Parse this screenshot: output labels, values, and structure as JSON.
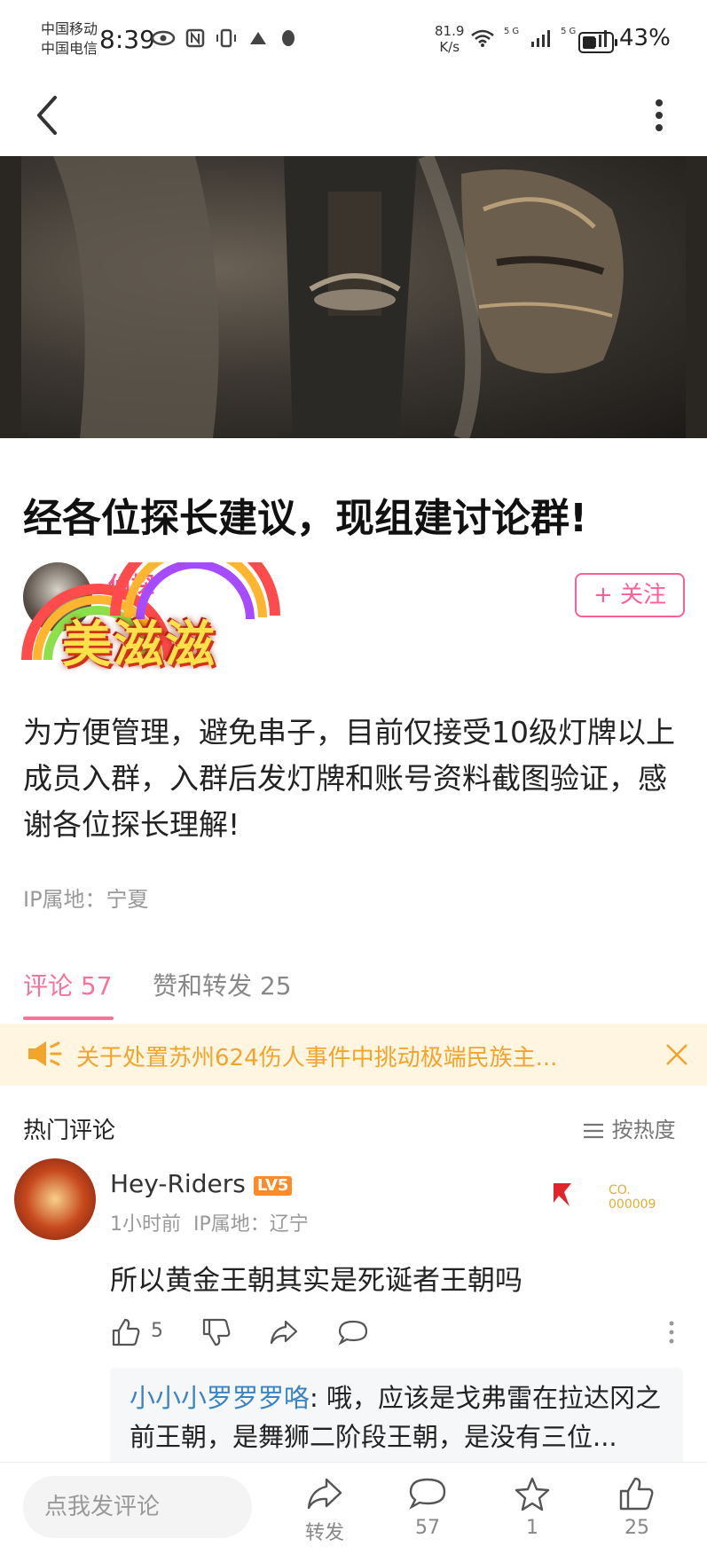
{
  "status_bar": {
    "carrier1": "中国移动",
    "carrier2": "中国电信",
    "time": "8:39",
    "speed_value": "81.9",
    "speed_unit": "K/s",
    "battery": "43%",
    "network1": "5G",
    "network2": "5G"
  },
  "post": {
    "title": "经各位探长建议，现组建讨论群!",
    "author_name": "侦探",
    "follow_label": "+ 关注",
    "badge_text": "美滋滋",
    "body": "为方便管理，避免串子，目前仅接受10级灯牌以上成员入群，入群后发灯牌和账号资料截图验证，感谢各位探长理解!",
    "ip": "IP属地：宁夏"
  },
  "tabs": {
    "comments": "评论 57",
    "likes_shares": "赞和转发 25"
  },
  "notice": {
    "text": "关于处置苏州624伤人事件中挑动极端民族主..."
  },
  "comments_section": {
    "hot_label": "热门评论",
    "sort_label": "按热度"
  },
  "comment": {
    "username": "Hey-Riders",
    "level": "LV5",
    "time": "1小时前",
    "ip": "IP属地：辽宁",
    "text": "所以黄金王朝其实是死诞者王朝吗",
    "likes": "5",
    "decor_text1": "CO.",
    "decor_text2": "000009",
    "reply_name": "小小小罗罗罗咯",
    "reply_text": ": 哦，应该是戈弗雷在拉达冈之前王朝，是舞狮二阶段王朝，是没有三位..."
  },
  "bottom_bar": {
    "input_placeholder": "点我发评论",
    "share_label": "转发",
    "comment_count": "57",
    "fav_count": "1",
    "like_count": "25"
  },
  "colors": {
    "accent": "#fb7299",
    "notice_bg": "#fff5e1",
    "notice_text": "#f3a42b",
    "reply_name": "#3b84c4"
  }
}
